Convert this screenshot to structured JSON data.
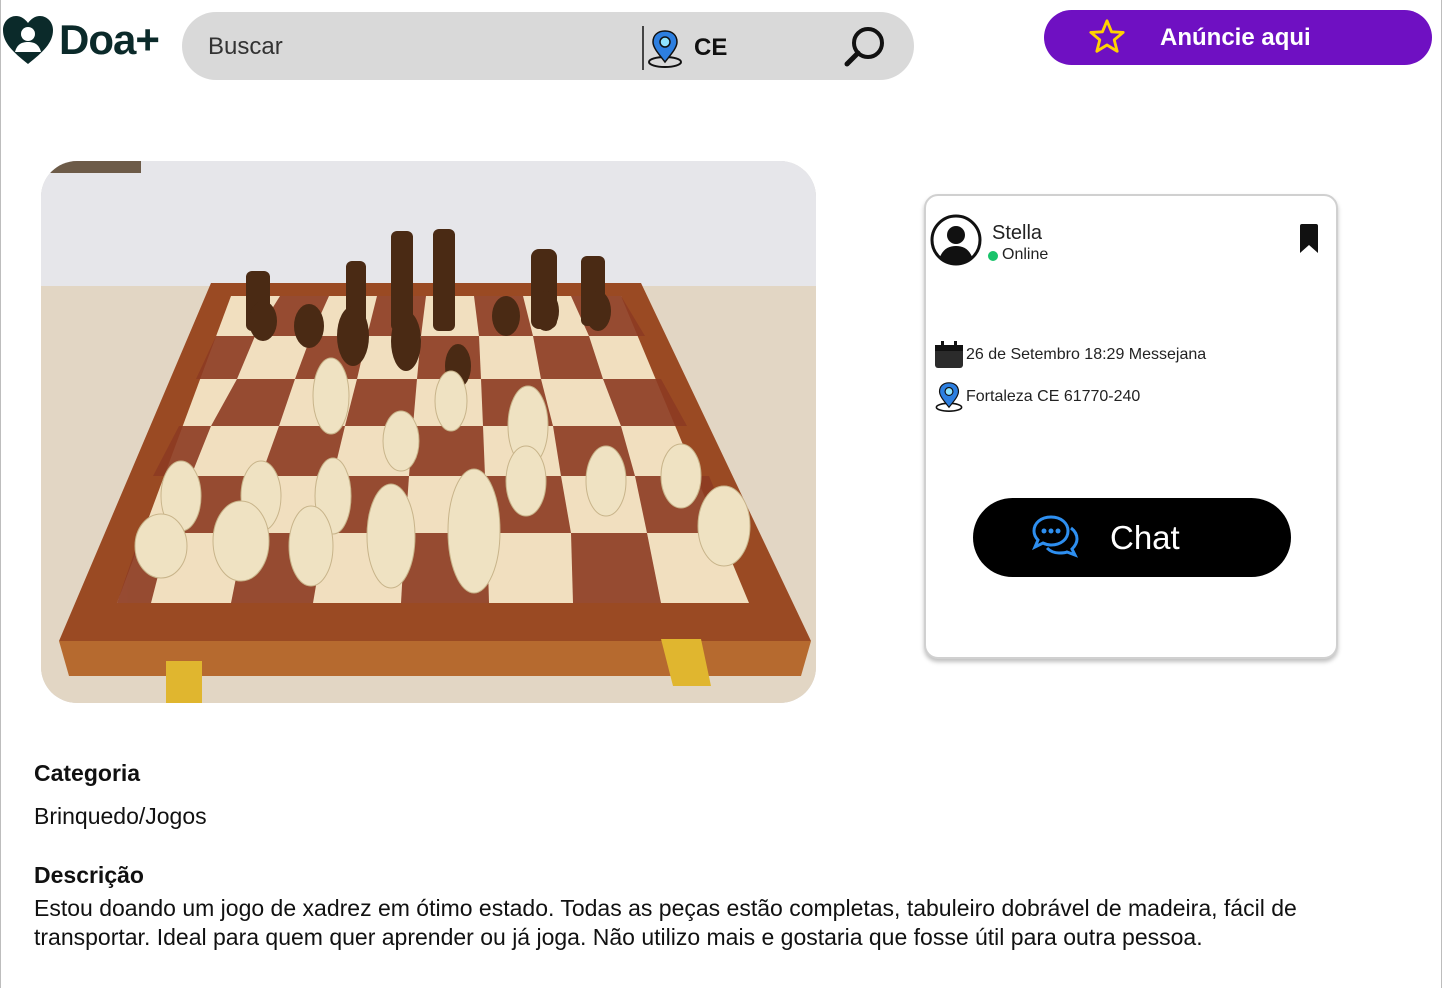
{
  "brand": {
    "name": "Doa+",
    "heart_color": "#0b2a2a"
  },
  "search": {
    "placeholder": "Buscar",
    "location": "CE"
  },
  "header": {
    "ad_button_label": "Anúncie aqui",
    "ad_button_color": "#6f10c2"
  },
  "listing": {
    "image_alt": "Jogo de xadrez",
    "donor": {
      "name": "Stella",
      "status": "Online"
    },
    "date_line": "26 de Setembro 18:29 Messejana",
    "address_line": "Fortaleza CE 61770-240",
    "chat_label": "Chat"
  },
  "details": {
    "category_title": "Categoria",
    "category_value": "Brinquedo/Jogos",
    "description_title": "Descrição",
    "description_text": "Estou doando um jogo de xadrez em ótimo estado. Todas as peças estão completas, tabuleiro dobrável de madeira, fácil de transportar. Ideal para quem quer aprender ou já joga. Não utilizo mais e gostaria que fosse útil para outra pessoa."
  },
  "icons": {
    "logo": "heart-icon",
    "location": "location-pin-icon",
    "search": "magnifier-icon",
    "star": "star-icon",
    "avatar": "user-avatar-icon",
    "bookmark": "bookmark-icon",
    "calendar": "calendar-icon",
    "chat": "chat-bubble-icon"
  }
}
